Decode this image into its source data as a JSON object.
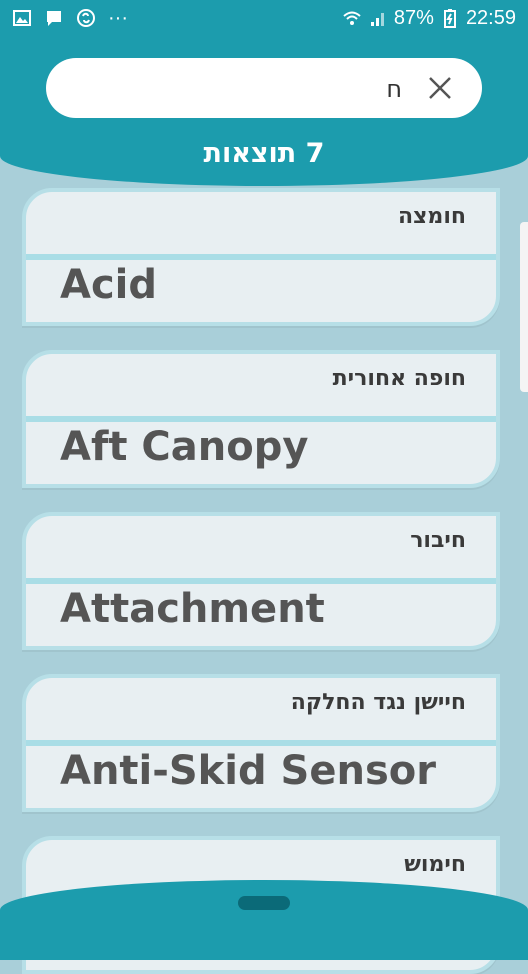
{
  "status_bar": {
    "battery_percent": "87%",
    "time": "22:59",
    "more": "···",
    "icons": [
      "image-icon",
      "chat-icon",
      "shazam-icon",
      "wifi-icon",
      "signal-icon",
      "battery-icon"
    ]
  },
  "search": {
    "value": "ח"
  },
  "results": {
    "label": "7 תוצאות"
  },
  "items": [
    {
      "he": "חומצה",
      "en": "Acid"
    },
    {
      "he": "חופה אחורית",
      "en": "Aft Canopy"
    },
    {
      "he": "חיבור",
      "en": "Attachment"
    },
    {
      "he": "חיישן נגד החלקה",
      "en": "Anti-Skid Sensor"
    },
    {
      "he": "חימוש",
      "en": ""
    }
  ],
  "colors": {
    "primary": "#1c9cad",
    "background": "#a9cfd9",
    "card": "#e8eff2",
    "card_border": "#b7dfe7"
  }
}
